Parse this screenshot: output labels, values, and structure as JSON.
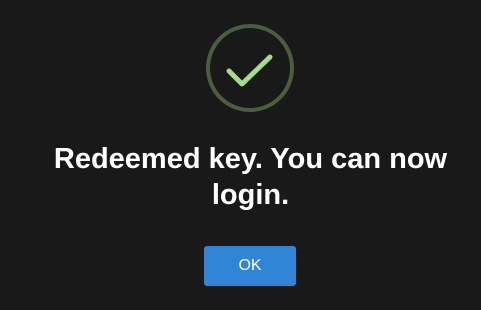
{
  "dialog": {
    "icon": "success-check-icon",
    "icon_ring_color": "#4b5d3f",
    "icon_check_color": "#a5dc86",
    "message": "Redeemed key. You can now login.",
    "confirm_label": "OK",
    "confirm_color": "#3085d6",
    "background_color": "#191919"
  }
}
